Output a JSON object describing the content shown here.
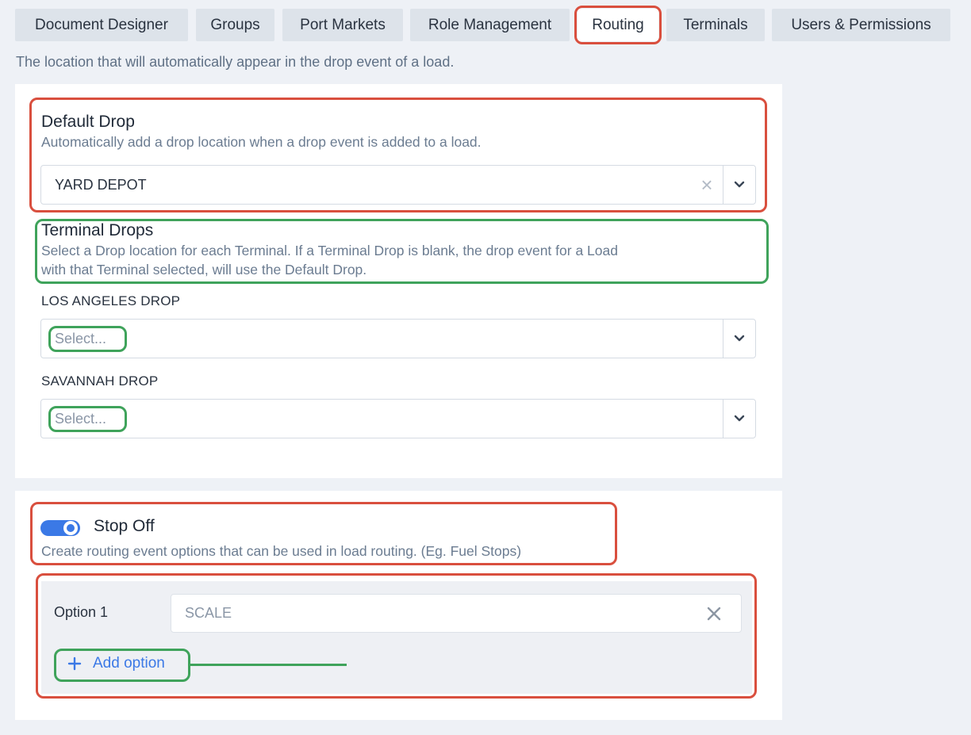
{
  "tabs": [
    {
      "label": "Document Designer"
    },
    {
      "label": "Groups"
    },
    {
      "label": "Port Markets"
    },
    {
      "label": "Role Management"
    },
    {
      "label": "Routing"
    },
    {
      "label": "Terminals"
    },
    {
      "label": "Users & Permissions"
    }
  ],
  "active_tab": "Routing",
  "page_description": "The location that will automatically appear in the drop event of a load.",
  "default_drop": {
    "title": "Default Drop",
    "description": "Automatically add a drop location when a drop event is added to a load.",
    "value": "YARD DEPOT"
  },
  "terminal_drops": {
    "title": "Terminal Drops",
    "description_line1": "Select a Drop location for each Terminal. If a Terminal Drop is blank, the drop event for a Load",
    "description_line2": "with that Terminal selected, will use the Default Drop.",
    "items": [
      {
        "label": "LOS ANGELES DROP",
        "placeholder": "Select..."
      },
      {
        "label": "SAVANNAH DROP",
        "placeholder": "Select..."
      }
    ]
  },
  "stop_off": {
    "title": "Stop Off",
    "enabled": true,
    "description": "Create routing event options that can be used in load routing. (Eg. Fuel Stops)",
    "options": [
      {
        "label": "Option 1",
        "value": "SCALE"
      }
    ],
    "add_label": "Add option"
  },
  "colors": {
    "accent": "#3b79e6",
    "annotation_red": "#d94f3e",
    "annotation_green": "#3fa35b"
  }
}
